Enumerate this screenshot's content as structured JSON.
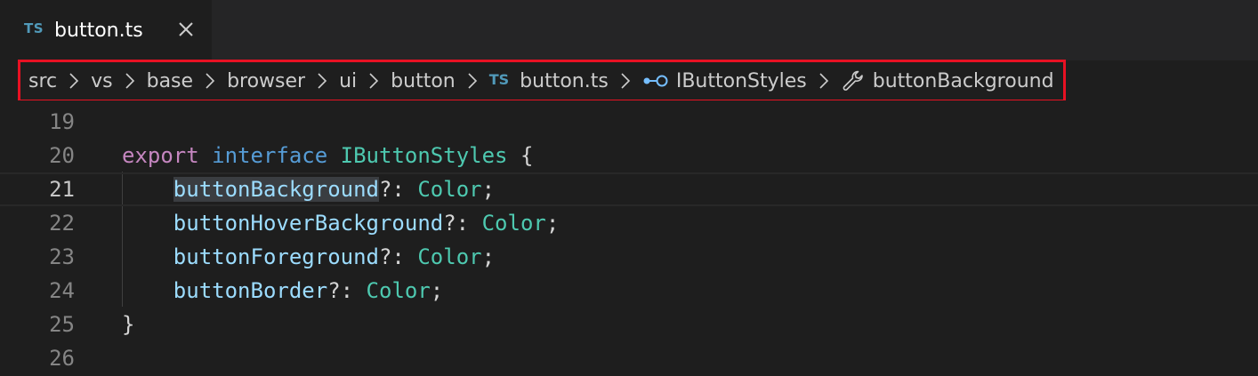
{
  "tab": {
    "badge": "TS",
    "label": "button.ts",
    "icons": [
      "ts-file-icon",
      "close-icon"
    ]
  },
  "breadcrumbs": {
    "items": [
      {
        "label": "src"
      },
      {
        "label": "vs"
      },
      {
        "label": "base"
      },
      {
        "label": "browser"
      },
      {
        "label": "ui"
      },
      {
        "label": "button"
      },
      {
        "label": "button.ts",
        "badge": "TS",
        "icon": "ts-file-icon"
      },
      {
        "label": "IButtonStyles",
        "icon": "interface-icon"
      },
      {
        "label": "buttonBackground",
        "icon": "wrench-icon"
      }
    ]
  },
  "editor": {
    "current_line": "21",
    "lines": [
      {
        "number": "19"
      },
      {
        "number": "20",
        "export": "export",
        "interface": "interface",
        "name": "IButtonStyles",
        "brace": "{"
      },
      {
        "number": "21",
        "prop": "buttonBackground",
        "suffix": "?: ",
        "type": "Color",
        "end": ";"
      },
      {
        "number": "22",
        "prop": "buttonHoverBackground",
        "suffix": "?: ",
        "type": "Color",
        "end": ";"
      },
      {
        "number": "23",
        "prop": "buttonForeground",
        "suffix": "?: ",
        "type": "Color",
        "end": ";"
      },
      {
        "number": "24",
        "prop": "buttonBorder",
        "suffix": "?: ",
        "type": "Color",
        "end": ";"
      },
      {
        "number": "25",
        "brace": "}"
      },
      {
        "number": "26"
      }
    ]
  },
  "colors": {
    "highlight_border": "#e81123",
    "ts_badge": "#519aba",
    "keyword_export": "#c586c0",
    "keyword_interface": "#569cd6",
    "type": "#4ec9b0",
    "property": "#9cdcfe"
  }
}
